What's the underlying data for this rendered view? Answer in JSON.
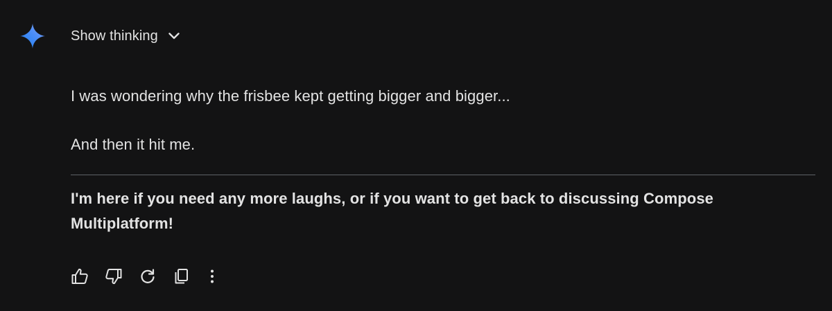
{
  "app": {
    "accent_gradient": [
      "#4285f4",
      "#9b72cb",
      "#1a73e8"
    ],
    "background": "#131314",
    "text_color": "#e3e3e3"
  },
  "thinking": {
    "label": "Show thinking",
    "icon": "chevron-down-icon"
  },
  "response": {
    "paragraphs": [
      "I was wondering why the frisbee kept getting bigger and bigger...",
      "And then it hit me."
    ],
    "closing": "I'm here if you need any more laughs, or if you want to get back to discussing Compose Multiplatform!"
  },
  "actions": [
    {
      "icon": "thumbs-up-icon"
    },
    {
      "icon": "thumbs-down-icon"
    },
    {
      "icon": "regenerate-icon"
    },
    {
      "icon": "copy-icon"
    },
    {
      "icon": "more-options-icon"
    }
  ]
}
